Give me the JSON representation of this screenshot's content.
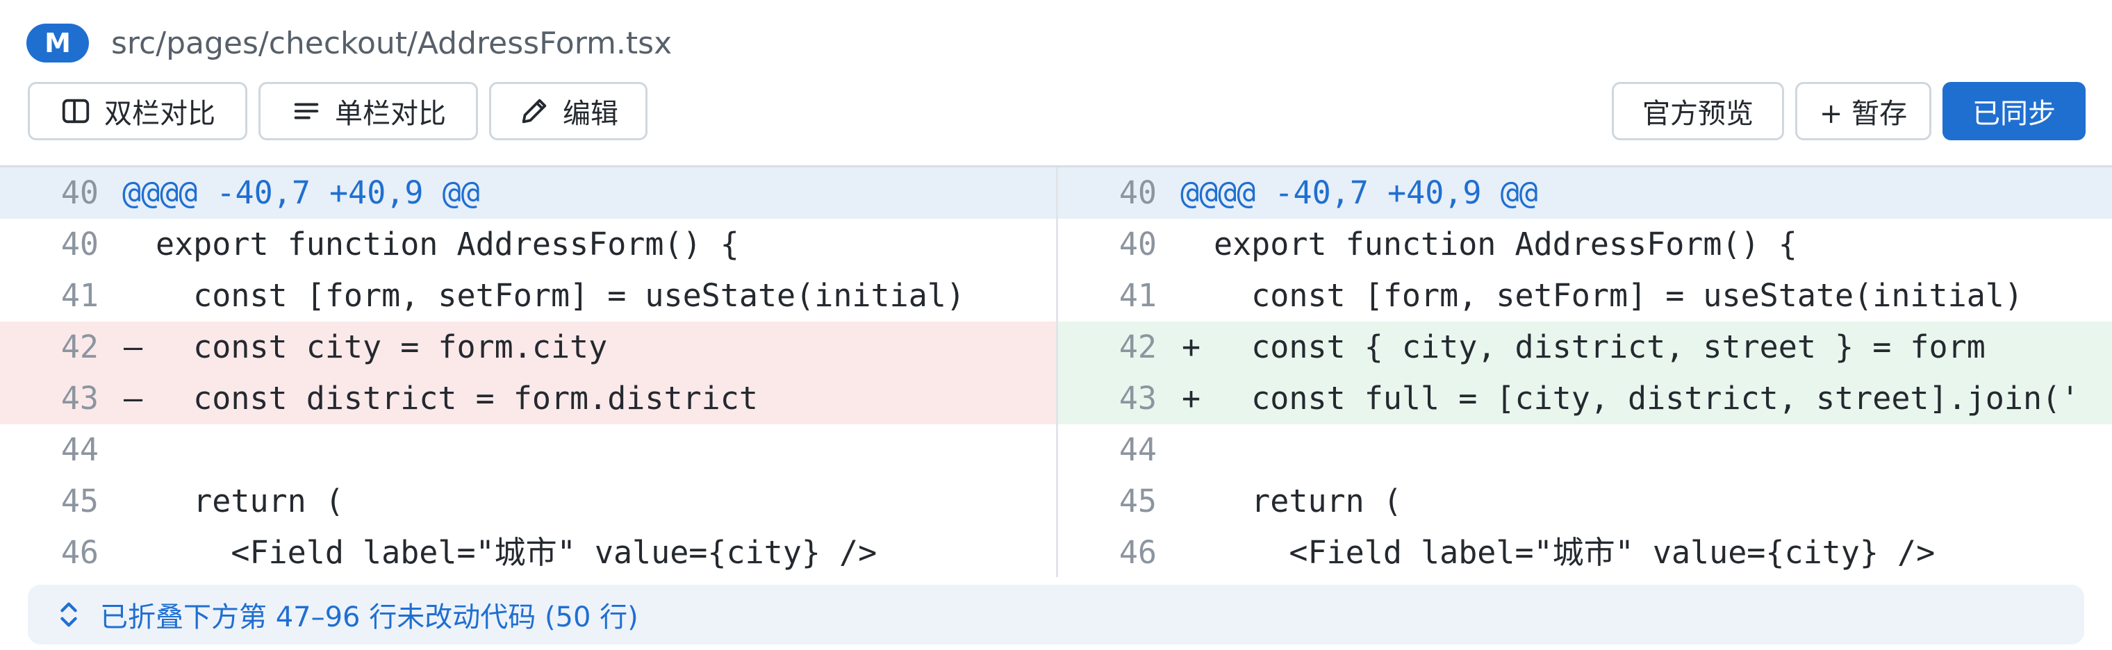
{
  "file": {
    "status_badge": "M",
    "path": "src/pages/checkout/AddressForm.tsx"
  },
  "toolbar": {
    "split_label": "双栏对比",
    "unified_label": "单栏对比",
    "edit_label": "编辑",
    "preview_label": "官方预览",
    "stash_label": "+ 暂存",
    "synced_label": "已同步"
  },
  "icons": {
    "split": "split-view-icon",
    "unified": "unified-view-icon",
    "edit": "pencil-icon",
    "fold": "chevron-up-down-icon"
  },
  "colors": {
    "accent": "#1f6fd1",
    "deleted_bg": "#fbe9ea",
    "added_bg": "#e9f6ee",
    "hunk_bg": "#e7eff8"
  },
  "diff": {
    "left": [
      {
        "type": "hunk",
        "ln": "40",
        "sign": "",
        "code": "@@@@ -40,7 +40,9 @@"
      },
      {
        "type": "ctx",
        "ln": "40",
        "sign": "",
        "code": "export function AddressForm() {"
      },
      {
        "type": "ctx",
        "ln": "41",
        "sign": "",
        "code": "  const [form, setForm] = useState(initial)"
      },
      {
        "type": "del",
        "ln": "42",
        "sign": "–",
        "code": "  const city = form.city"
      },
      {
        "type": "del",
        "ln": "43",
        "sign": "–",
        "code": "  const district = form.district"
      },
      {
        "type": "ctx",
        "ln": "44",
        "sign": "",
        "code": ""
      },
      {
        "type": "ctx",
        "ln": "45",
        "sign": "",
        "code": "  return ("
      },
      {
        "type": "ctx",
        "ln": "46",
        "sign": "",
        "code": "    <Field label=\"城市\" value={city} />"
      }
    ],
    "right": [
      {
        "type": "hunk",
        "ln": "40",
        "sign": "",
        "code": "@@@@ -40,7 +40,9 @@"
      },
      {
        "type": "ctx",
        "ln": "40",
        "sign": "",
        "code": "export function AddressForm() {"
      },
      {
        "type": "ctx",
        "ln": "41",
        "sign": "",
        "code": "  const [form, setForm] = useState(initial)"
      },
      {
        "type": "add",
        "ln": "42",
        "sign": "+",
        "code": "  const { city, district, street } = form"
      },
      {
        "type": "add",
        "ln": "43",
        "sign": "+",
        "code": "  const full = [city, district, street].join('"
      },
      {
        "type": "ctx",
        "ln": "44",
        "sign": "",
        "code": ""
      },
      {
        "type": "ctx",
        "ln": "45",
        "sign": "",
        "code": "  return ("
      },
      {
        "type": "ctx",
        "ln": "46",
        "sign": "",
        "code": "    <Field label=\"城市\" value={city} />"
      }
    ]
  },
  "fold": {
    "label": "已折叠下方第 47–96 行未改动代码 (50 行)"
  }
}
